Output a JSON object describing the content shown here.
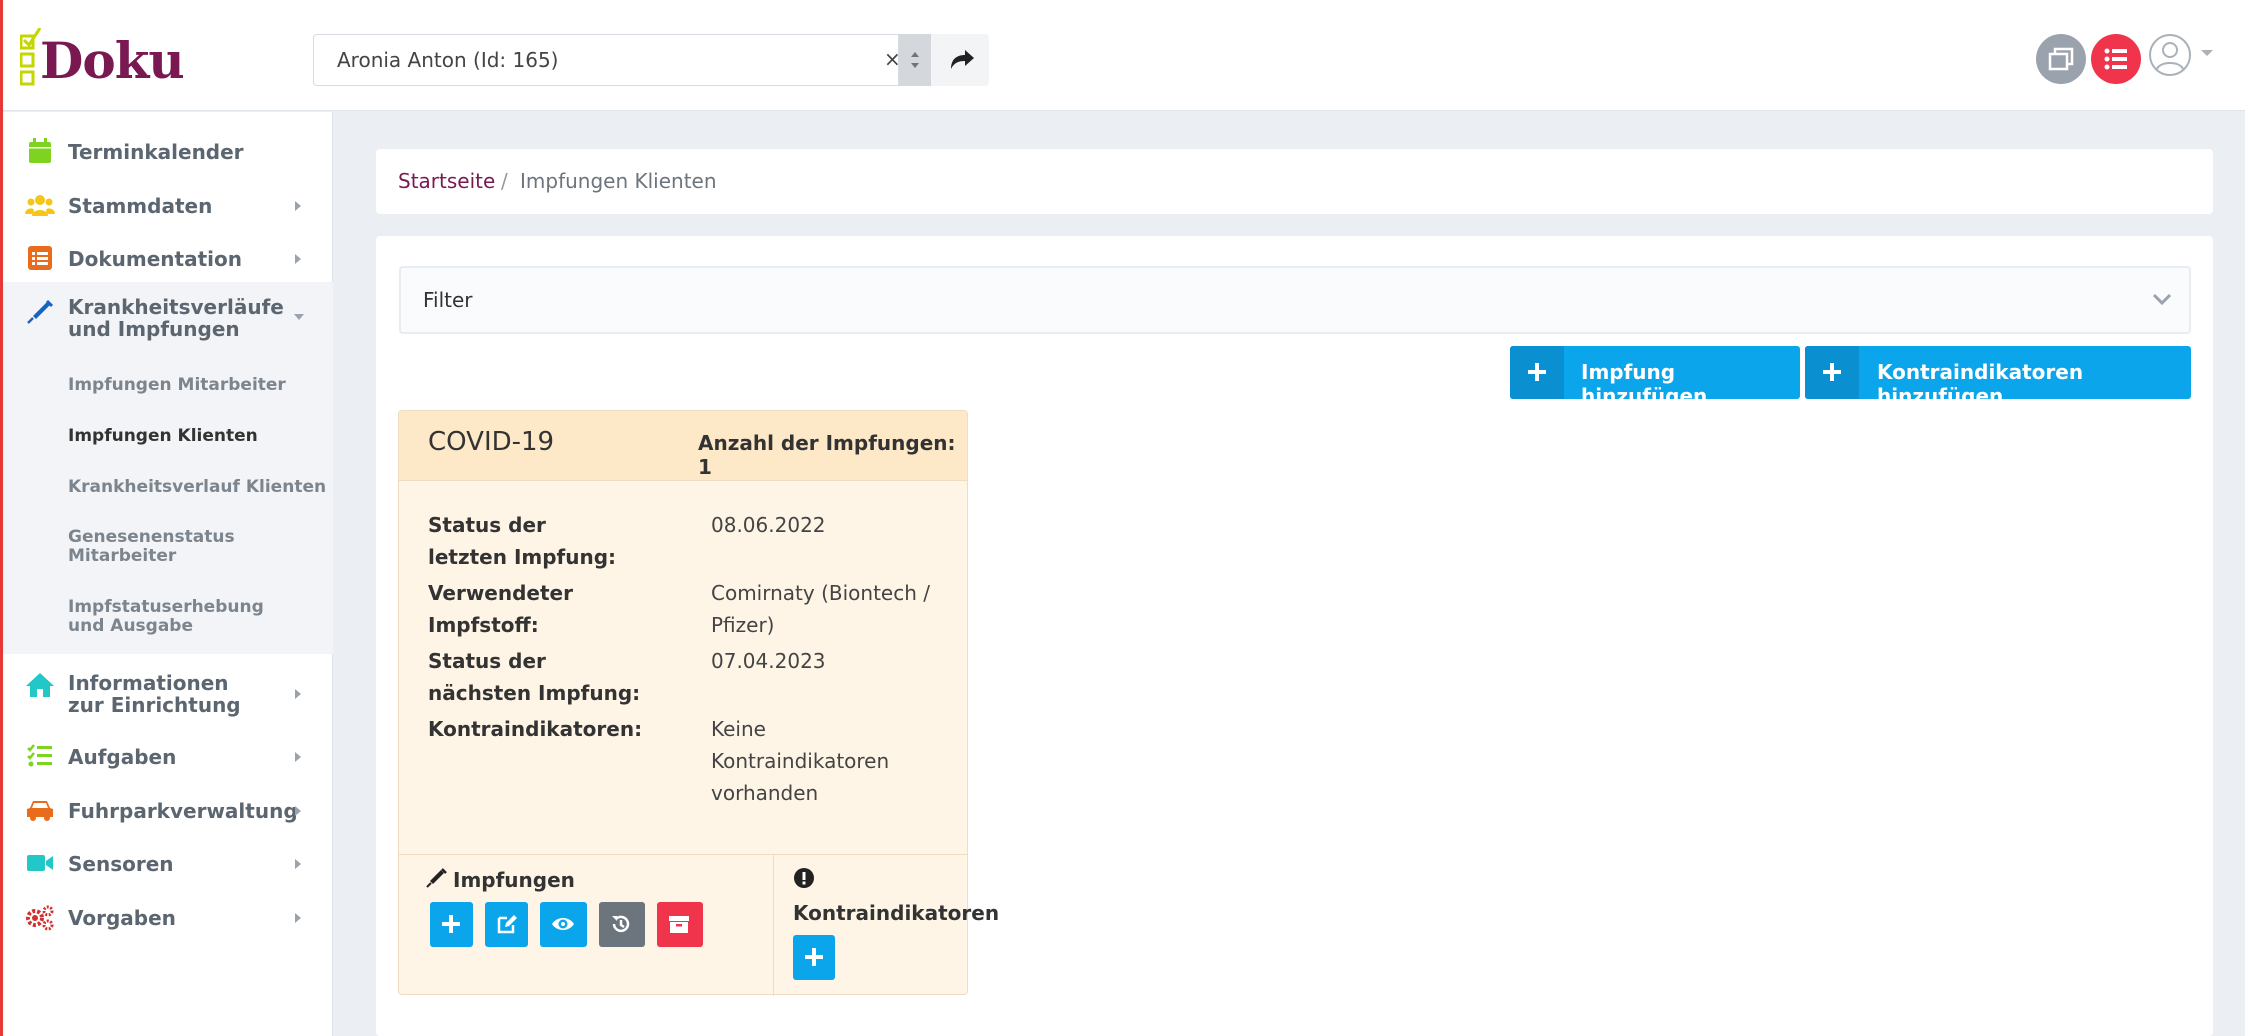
{
  "app": {
    "logo_text": "Doku",
    "client_select": {
      "value": "Aronia Anton (Id: 165)",
      "clear": "×"
    }
  },
  "sidebar": {
    "items": [
      {
        "label": "Terminkalender",
        "icon": "calendar-icon",
        "color": "#7ed321"
      },
      {
        "label": "Stammdaten",
        "icon": "users-icon",
        "color": "#f5c518"
      },
      {
        "label": "Dokumentation",
        "icon": "list-alt-icon",
        "color": "#e86c1c"
      },
      {
        "label": "Krankheitsverläufe und Impfungen",
        "icon": "syringe-icon",
        "color": "#1565c0"
      },
      {
        "label": "Informationen zur Einrichtung",
        "icon": "home-icon",
        "color": "#22c7c7"
      },
      {
        "label": "Aufgaben",
        "icon": "tasks-icon",
        "color": "#7ed321"
      },
      {
        "label": "Fuhrparkverwaltung",
        "icon": "car-icon",
        "color": "#e86c1c"
      },
      {
        "label": "Sensoren",
        "icon": "video-icon",
        "color": "#22c7c7"
      },
      {
        "label": "Vorgaben",
        "icon": "cogs-icon",
        "color": "#d32f2f"
      }
    ],
    "subitems": [
      {
        "label": "Impfungen Mitarbeiter"
      },
      {
        "label": "Impfungen Klienten"
      },
      {
        "label": "Krankheitsverlauf Klienten"
      },
      {
        "label": "Genesenenstatus Mitarbeiter"
      },
      {
        "label": "Impfstatuserhebung und Ausgabe"
      }
    ]
  },
  "breadcrumb": {
    "home": "Startseite",
    "separator": "/",
    "current": "Impfungen Klienten"
  },
  "filter": {
    "label": "Filter"
  },
  "actions": {
    "add_vaccination": "Impfung hinzufügen",
    "add_contraindications": "Kontraindikatoren hinzufügen"
  },
  "card": {
    "title": "COVID-19",
    "count": "Anzahl der Impfungen: 1",
    "rows": [
      {
        "label": "Status der letzten Impfung:",
        "value": "08.06.2022"
      },
      {
        "label": "Verwendeter Impfstoff:",
        "value": "Comirnaty (Biontech / Pfizer)"
      },
      {
        "label": "Status der nächsten Impfung:",
        "value": "07.04.2023"
      },
      {
        "label": "Kontraindikatoren:",
        "value": "Keine Kontraindikatoren vorhanden"
      }
    ],
    "footer": {
      "impfungen_label": "Impfungen",
      "kontra_label": "Kontraindikatoren"
    }
  },
  "colors": {
    "brand": "#7a1852",
    "primary_button": "#0ba5ec",
    "danger": "#f0344c",
    "card_bg": "#fef5e6"
  }
}
